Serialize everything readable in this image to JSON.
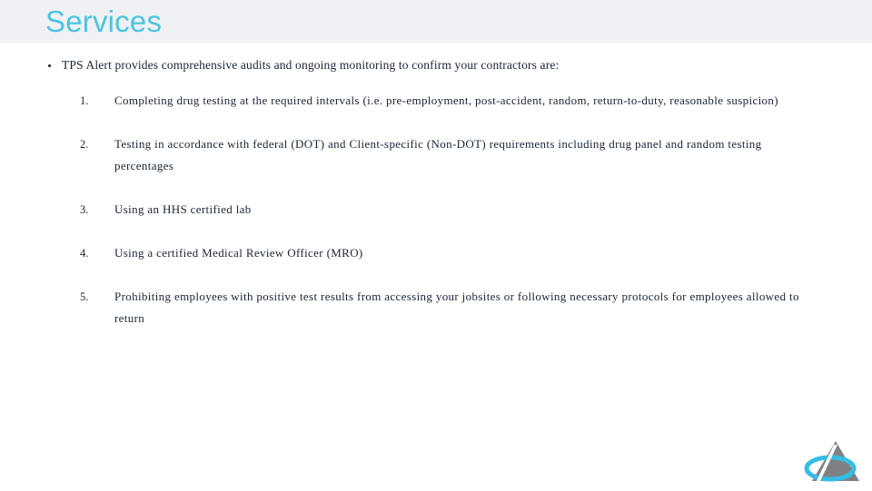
{
  "slide": {
    "title": "Services",
    "title_color": "#4bc4e2",
    "header_band_color": "#f0f1f4",
    "background_color": "#ffffff",
    "text_color": "#1b2438"
  },
  "intro": {
    "bullet_marker": "bullet-dot",
    "text": "TPS Alert provides comprehensive audits and ongoing monitoring to confirm your contractors are:"
  },
  "numbered_list": [
    {
      "number": "1.",
      "text": "Completing drug testing at the required intervals (i.e. pre-employment, post-accident, random, return-to-duty, reasonable suspicion)"
    },
    {
      "number": "2.",
      "text": "Testing in accordance with federal (DOT) and Client-specific (Non-DOT) requirements including drug panel and random testing percentages"
    },
    {
      "number": "3.",
      "text": "Using an HHS certified lab"
    },
    {
      "number": "4.",
      "text": "Using a certified Medical Review Officer (MRO)"
    },
    {
      "number": "5.",
      "text": "Prohibiting employees with positive test results from accessing your jobsites or following necessary protocols for employees allowed to return"
    }
  ],
  "logo": {
    "name": "triangle-swoosh-logo",
    "triangle_color": "#808184",
    "swoosh_color": "#36bde4"
  }
}
